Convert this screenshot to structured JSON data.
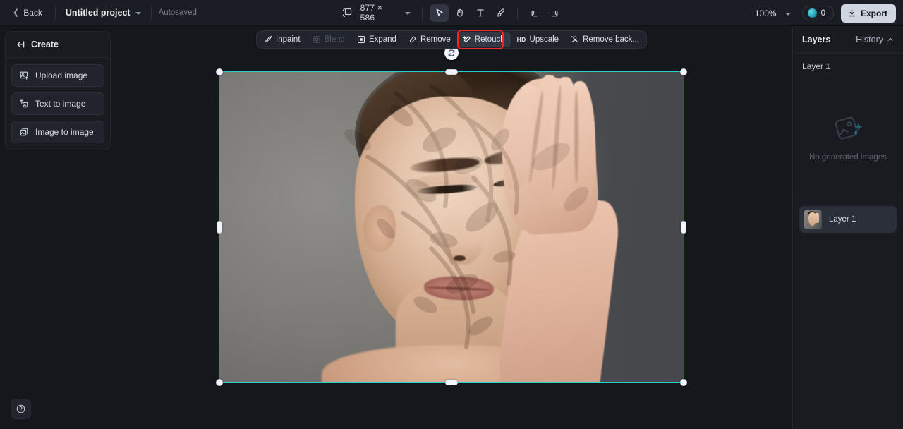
{
  "topbar": {
    "back_label": "Back",
    "project_name": "Untitled project",
    "autosaved_label": "Autosaved",
    "canvas_size": "877 × 586",
    "zoom_level": "100%",
    "credits_count": "0",
    "export_label": "Export",
    "tools": [
      {
        "name": "select-tool",
        "glyph": "cursor",
        "active": true
      },
      {
        "name": "hand-tool",
        "glyph": "hand",
        "active": false
      },
      {
        "name": "text-tool",
        "glyph": "T",
        "active": false
      },
      {
        "name": "brush-tool",
        "glyph": "brush",
        "active": false
      }
    ],
    "undo_label": "Undo",
    "redo_label": "Redo"
  },
  "sidebar": {
    "title": "Create",
    "collapse_icon": "collapse-left-icon",
    "items": [
      {
        "label": "Upload image",
        "icon": "upload-image-icon"
      },
      {
        "label": "Text to image",
        "icon": "text-to-image-icon"
      },
      {
        "label": "Image to image",
        "icon": "image-to-image-icon"
      }
    ],
    "help_label": "?"
  },
  "float_toolbar": {
    "items": [
      {
        "label": "Inpaint",
        "icon": "inpaint-icon",
        "state": "normal"
      },
      {
        "label": "Blend",
        "icon": "blend-icon",
        "state": "disabled"
      },
      {
        "label": "Expand",
        "icon": "expand-icon",
        "state": "normal"
      },
      {
        "label": "Remove",
        "icon": "remove-icon",
        "state": "normal"
      },
      {
        "label": "Retouch",
        "icon": "retouch-icon",
        "state": "selected"
      },
      {
        "label": "Upscale",
        "icon": "hd-icon",
        "state": "normal"
      },
      {
        "label": "Remove back...",
        "icon": "remove-background-icon",
        "state": "normal"
      }
    ],
    "highlighted_item": "Retouch",
    "highlight_color": "#f22424"
  },
  "canvas": {
    "selection_color": "#1fd6c9",
    "rotate_handle_icon": "rotate-icon",
    "image_alt": "Portrait of a woman with eyes closed, hand resting on her face, dappled shadow pattern, grey studio background"
  },
  "rightpanel": {
    "tab_layers": "Layers",
    "tab_history": "History",
    "history_chevron": "chevron-up-icon",
    "layer_heading": "Layer 1",
    "empty_state_text": "No generated images",
    "empty_state_icon": "image-placeholder-icon",
    "layers": [
      {
        "name": "Layer 1"
      }
    ]
  }
}
